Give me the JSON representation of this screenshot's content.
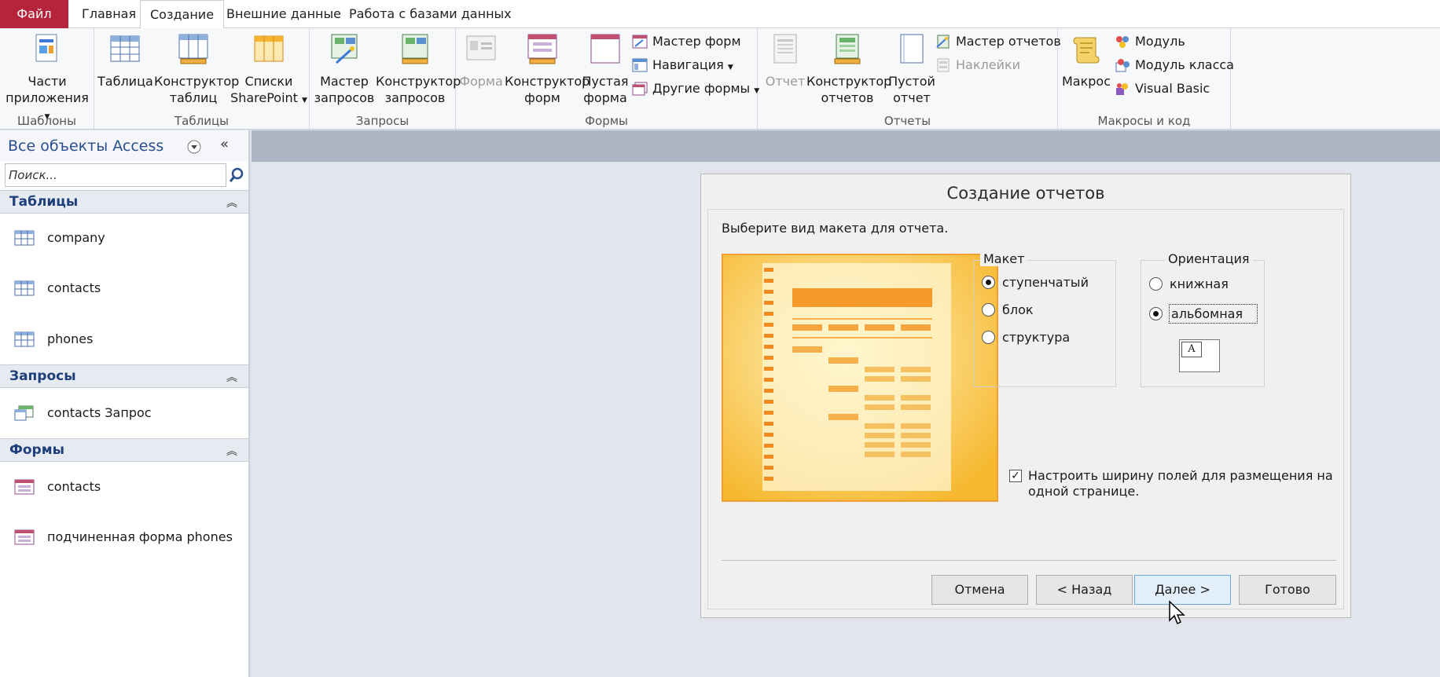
{
  "tabs": {
    "file": "Файл",
    "home": "Главная",
    "create": "Создание",
    "external": "Внешние данные",
    "database": "Работа с базами данных"
  },
  "ribbon": {
    "templates": {
      "parts_line1": "Части",
      "parts_line2": "приложения",
      "label": "Шаблоны"
    },
    "tables": {
      "table": "Таблица",
      "designer_line1": "Конструктор",
      "designer_line2": "таблиц",
      "sharepoint_line1": "Списки",
      "sharepoint_line2": "SharePoint",
      "label": "Таблицы"
    },
    "queries": {
      "wizard_line1": "Мастер",
      "wizard_line2": "запросов",
      "designer_line1": "Конструктор",
      "designer_line2": "запросов",
      "label": "Запросы"
    },
    "forms": {
      "form": "Форма",
      "designer_line1": "Конструктор",
      "designer_line2": "форм",
      "blank_line1": "Пустая",
      "blank_line2": "форма",
      "wizard": "Мастер форм",
      "navigation": "Навигация",
      "other": "Другие формы",
      "label": "Формы"
    },
    "reports": {
      "report": "Отчет",
      "designer_line1": "Конструктор",
      "designer_line2": "отчетов",
      "blank_line1": "Пустой",
      "blank_line2": "отчет",
      "wizard": "Мастер отчетов",
      "labels": "Наклейки",
      "label": "Отчеты"
    },
    "macros": {
      "macro": "Макрос",
      "module": "Модуль",
      "class_module": "Модуль класса",
      "vb": "Visual Basic",
      "label": "Макросы и код"
    }
  },
  "nav": {
    "title": "Все объекты Access",
    "search_placeholder": "Поиск...",
    "sections": {
      "tables": {
        "label": "Таблицы",
        "items": [
          "company",
          "contacts",
          "phones"
        ]
      },
      "queries": {
        "label": "Запросы",
        "items": [
          "contacts Запрос"
        ]
      },
      "forms": {
        "label": "Формы",
        "items": [
          "contacts",
          "подчиненная форма phones"
        ]
      }
    }
  },
  "dialog": {
    "title": "Создание отчетов",
    "prompt": "Выберите вид макета для отчета.",
    "layout": {
      "legend": "Макет",
      "options": [
        "ступенчатый",
        "блок",
        "структура"
      ],
      "selected": 0
    },
    "orientation": {
      "legend": "Ориентация",
      "options": [
        "книжная",
        "альбомная"
      ],
      "selected": 1,
      "icon_letter": "A"
    },
    "fit_checkbox": {
      "checked": true,
      "label": "Настроить ширину полей для размещения на одной странице."
    },
    "buttons": {
      "cancel": "Отмена",
      "back": "< Назад",
      "next": "Далее >",
      "finish": "Готово"
    }
  },
  "colors": {
    "file_tab": "#b5243a",
    "nav_title": "#2a4f8f",
    "section_label": "#1f3f7a",
    "preview_orange": "#f0a030"
  }
}
